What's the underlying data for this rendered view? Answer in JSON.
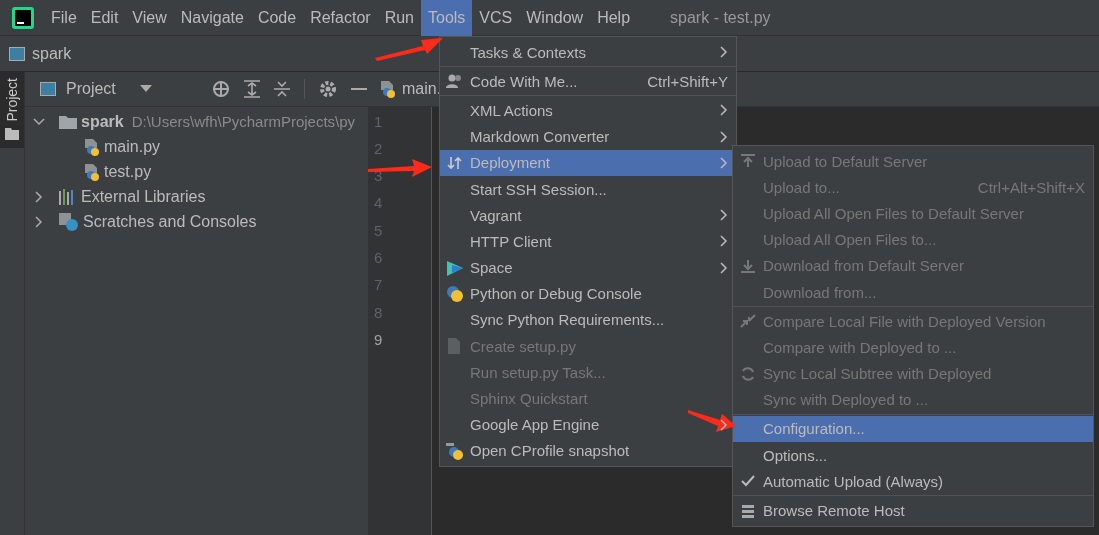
{
  "menu_bar": [
    {
      "label": "File",
      "selected": false
    },
    {
      "label": "Edit",
      "selected": false
    },
    {
      "label": "View",
      "selected": false
    },
    {
      "label": "Navigate",
      "selected": false
    },
    {
      "label": "Code",
      "selected": false
    },
    {
      "label": "Refactor",
      "selected": false
    },
    {
      "label": "Run",
      "selected": false
    },
    {
      "label": "Tools",
      "selected": true
    },
    {
      "label": "VCS",
      "selected": false
    },
    {
      "label": "Window",
      "selected": false
    },
    {
      "label": "Help",
      "selected": false
    }
  ],
  "window_title": "spark - test.py",
  "navigation_bar": {
    "label": "spark"
  },
  "tool_strip": {
    "label": "Project"
  },
  "project_panel": {
    "title": "Project",
    "tree": [
      {
        "label": "spark",
        "path": "D:\\Users\\wfh\\PycharmProjects\\py",
        "expanded": true,
        "children": [
          {
            "label": "main.py"
          },
          {
            "label": "test.py"
          }
        ]
      },
      {
        "label": "External Libraries",
        "expanded": false
      },
      {
        "label": "Scratches and Consoles",
        "expanded": false
      }
    ]
  },
  "editor": {
    "tab": "main.",
    "line_numbers": [
      {
        "label": "1",
        "current": false
      },
      {
        "label": "2",
        "current": false
      },
      {
        "label": "3",
        "current": false
      },
      {
        "label": "4",
        "current": false
      },
      {
        "label": "5",
        "current": false
      },
      {
        "label": "6",
        "current": false
      },
      {
        "label": "7",
        "current": false
      },
      {
        "label": "8",
        "current": false
      },
      {
        "label": "9",
        "current": true
      }
    ]
  },
  "tools_menu": [
    {
      "kind": "item",
      "label": "Tasks & Contexts",
      "submenu": true,
      "disabled": false,
      "selected": false
    },
    {
      "kind": "separator"
    },
    {
      "kind": "item",
      "label": "Code With Me...",
      "shortcut": "Ctrl+Shift+Y",
      "submenu": false,
      "disabled": false,
      "selected": false
    },
    {
      "kind": "separator"
    },
    {
      "kind": "item",
      "label": "XML Actions",
      "submenu": true,
      "disabled": false,
      "selected": false
    },
    {
      "kind": "item",
      "label": "Markdown Converter",
      "submenu": true,
      "disabled": false,
      "selected": false
    },
    {
      "kind": "item",
      "label": "Deployment",
      "submenu": true,
      "disabled": false,
      "selected": true
    },
    {
      "kind": "item",
      "label": "Start SSH Session...",
      "submenu": false,
      "disabled": false,
      "selected": false
    },
    {
      "kind": "item",
      "label": "Vagrant",
      "submenu": true,
      "disabled": false,
      "selected": false
    },
    {
      "kind": "item",
      "label": "HTTP Client",
      "submenu": true,
      "disabled": false,
      "selected": false
    },
    {
      "kind": "item",
      "label": "Space",
      "submenu": true,
      "disabled": false,
      "selected": false
    },
    {
      "kind": "item",
      "label": "Python or Debug Console",
      "submenu": false,
      "disabled": false,
      "selected": false
    },
    {
      "kind": "item",
      "label": "Sync Python Requirements...",
      "submenu": false,
      "disabled": false,
      "selected": false
    },
    {
      "kind": "item",
      "label": "Create setup.py",
      "submenu": false,
      "disabled": true,
      "selected": false
    },
    {
      "kind": "item",
      "label": "Run setup.py Task...",
      "submenu": false,
      "disabled": true,
      "selected": false
    },
    {
      "kind": "item",
      "label": "Sphinx Quickstart",
      "submenu": false,
      "disabled": true,
      "selected": false
    },
    {
      "kind": "item",
      "label": "Google App Engine",
      "submenu": true,
      "disabled": false,
      "selected": false
    },
    {
      "kind": "item",
      "label": "Open CProfile snapshot",
      "submenu": false,
      "disabled": false,
      "selected": false
    }
  ],
  "deployment_submenu": [
    {
      "kind": "item",
      "label": "Upload to Default Server",
      "disabled": true,
      "selected": false,
      "checked": false
    },
    {
      "kind": "item",
      "label": "Upload to...",
      "shortcut": "Ctrl+Alt+Shift+X",
      "disabled": true,
      "selected": false,
      "checked": false
    },
    {
      "kind": "item",
      "label": "Upload All Open Files to Default Server",
      "disabled": true,
      "selected": false,
      "checked": false
    },
    {
      "kind": "item",
      "label": "Upload All Open Files to...",
      "disabled": true,
      "selected": false,
      "checked": false
    },
    {
      "kind": "item",
      "label": "Download from Default Server",
      "disabled": true,
      "selected": false,
      "checked": false
    },
    {
      "kind": "item",
      "label": "Download from...",
      "disabled": true,
      "selected": false,
      "checked": false
    },
    {
      "kind": "separator"
    },
    {
      "kind": "item",
      "label": "Compare Local File with Deployed Version",
      "disabled": true,
      "selected": false,
      "checked": false
    },
    {
      "kind": "item",
      "label": "Compare with Deployed to ...",
      "disabled": true,
      "selected": false,
      "checked": false
    },
    {
      "kind": "item",
      "label": "Sync Local Subtree with Deployed",
      "disabled": true,
      "selected": false,
      "checked": false
    },
    {
      "kind": "item",
      "label": "Sync with Deployed to ...",
      "disabled": true,
      "selected": false,
      "checked": false
    },
    {
      "kind": "separator"
    },
    {
      "kind": "item",
      "label": "Configuration...",
      "disabled": false,
      "selected": true,
      "checked": false
    },
    {
      "kind": "item",
      "label": "Options...",
      "disabled": false,
      "selected": false,
      "checked": false
    },
    {
      "kind": "item",
      "label": "Automatic Upload (Always)",
      "disabled": false,
      "selected": false,
      "checked": true
    },
    {
      "kind": "separator"
    },
    {
      "kind": "item",
      "label": "Browse Remote Host",
      "disabled": false,
      "selected": false,
      "checked": false
    }
  ]
}
